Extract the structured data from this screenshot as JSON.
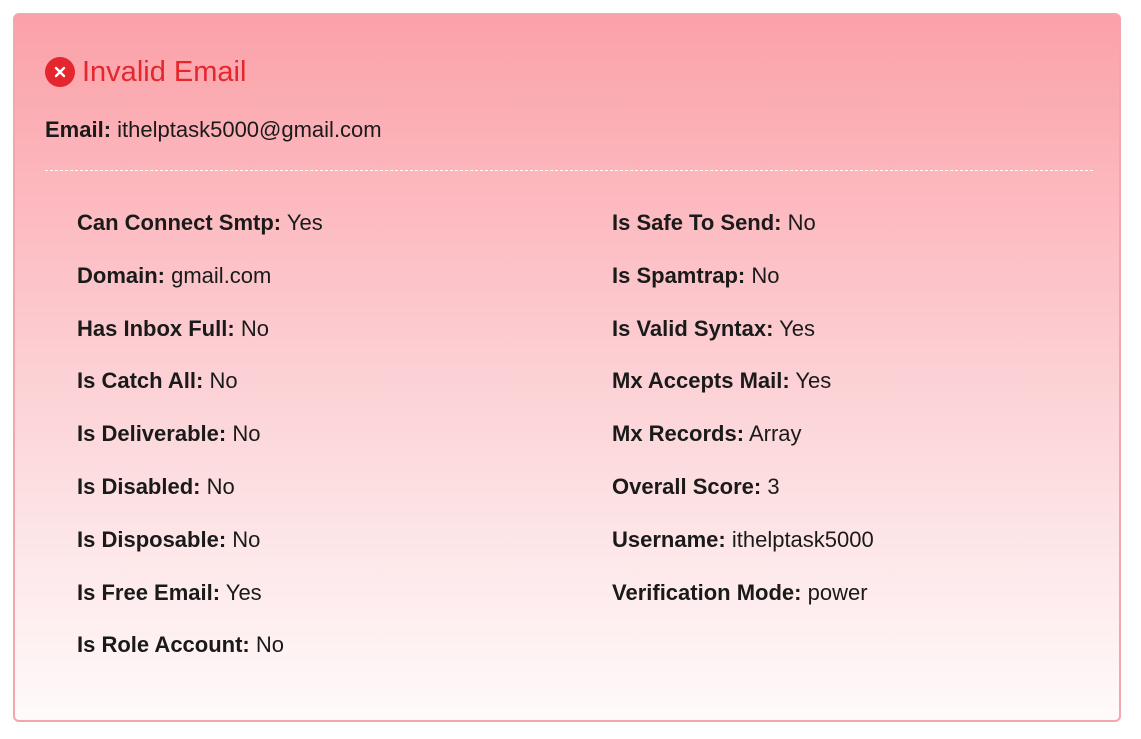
{
  "status": {
    "icon": "close-circle-icon",
    "title": "Invalid Email",
    "color": "#e5262e"
  },
  "email": {
    "label": "Email:",
    "value": "ithelptask5000@gmail.com"
  },
  "left_fields": [
    {
      "label": "Can Connect Smtp:",
      "value": "Yes"
    },
    {
      "label": "Domain:",
      "value": "gmail.com"
    },
    {
      "label": "Has Inbox Full:",
      "value": "No"
    },
    {
      "label": "Is Catch All:",
      "value": "No"
    },
    {
      "label": "Is Deliverable:",
      "value": "No"
    },
    {
      "label": "Is Disabled:",
      "value": "No"
    },
    {
      "label": "Is Disposable:",
      "value": "No"
    },
    {
      "label": "Is Free Email:",
      "value": "Yes"
    },
    {
      "label": "Is Role Account:",
      "value": "No"
    }
  ],
  "right_fields": [
    {
      "label": "Is Safe To Send:",
      "value": "No"
    },
    {
      "label": "Is Spamtrap:",
      "value": "No"
    },
    {
      "label": "Is Valid Syntax:",
      "value": "Yes"
    },
    {
      "label": "Mx Accepts Mail:",
      "value": "Yes"
    },
    {
      "label": "Mx Records:",
      "value": "Array"
    },
    {
      "label": "Overall Score:",
      "value": "3"
    },
    {
      "label": "Username:",
      "value": "ithelptask5000"
    },
    {
      "label": "Verification Mode:",
      "value": "power"
    }
  ]
}
